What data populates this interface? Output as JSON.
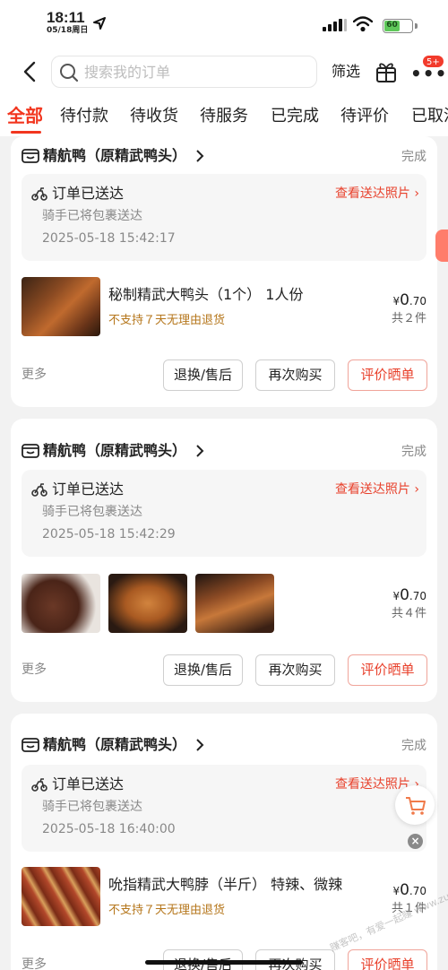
{
  "status_bar": {
    "time": "18:11",
    "date": "05/18周日",
    "battery": "60",
    "battery_level": 0.6
  },
  "header": {
    "search_placeholder": "搜索我的订单",
    "filter_label": "筛选",
    "more_badge": "5+",
    "icons": {
      "back": "chevron-left-icon",
      "search": "search-icon",
      "gift": "gift-icon",
      "more": "more-dots-icon"
    }
  },
  "tabs": [
    {
      "label": "全部",
      "active": true
    },
    {
      "label": "待付款"
    },
    {
      "label": "待收货"
    },
    {
      "label": "待服务"
    },
    {
      "label": "已完成"
    },
    {
      "label": "待评价"
    },
    {
      "label": "已取消"
    }
  ],
  "orders": [
    {
      "shop_name": "精航鸭（原精武鸭头）",
      "status": "完成",
      "delivery_title": "订单已送达",
      "delivery_link": "查看送达照片",
      "delivery_sub": "骑手已将包裹送达",
      "delivery_time": "2025-05-18 15:42:17",
      "product_name": "秘制精武大鸭头（1个） 1人份",
      "product_note": "不支持７天无理由退货",
      "price_currency": "¥",
      "price_int": "0",
      "price_dec": ".70",
      "qty": "共２件",
      "more": "更多",
      "btn_return": "退换/售后",
      "btn_rebuy": "再次购买",
      "btn_review": "评价晒单"
    },
    {
      "shop_name": "精航鸭（原精武鸭头）",
      "status": "完成",
      "delivery_title": "订单已送达",
      "delivery_link": "查看送达照片",
      "delivery_sub": "骑手已将包裹送达",
      "delivery_time": "2025-05-18 15:42:29",
      "price_currency": "¥",
      "price_int": "0",
      "price_dec": ".70",
      "qty": "共４件",
      "more": "更多",
      "btn_return": "退换/售后",
      "btn_rebuy": "再次购买",
      "btn_review": "评价晒单"
    },
    {
      "shop_name": "精航鸭（原精武鸭头）",
      "status": "完成",
      "delivery_title": "订单已送达",
      "delivery_link": "查看送达照片",
      "delivery_sub": "骑手已将包裹送达",
      "delivery_time": "2025-05-18 16:40:00",
      "product_name": "吮指精武大鸭脖（半斤） 特辣、微辣",
      "product_note": "不支持７天无理由退货",
      "price_currency": "¥",
      "price_int": "0",
      "price_dec": ".70",
      "qty": "共１件",
      "more": "更多",
      "btn_return": "退换/售后",
      "btn_rebuy": "再次购买",
      "btn_review": "评价晒单"
    }
  ],
  "colors": {
    "accent": "#f2361f",
    "link": "#e8412c",
    "note": "#b5761b",
    "page_bg": "#f2f2f2"
  },
  "watermark": "赚客吧，有爱一起赚 www.zuanke8.com"
}
